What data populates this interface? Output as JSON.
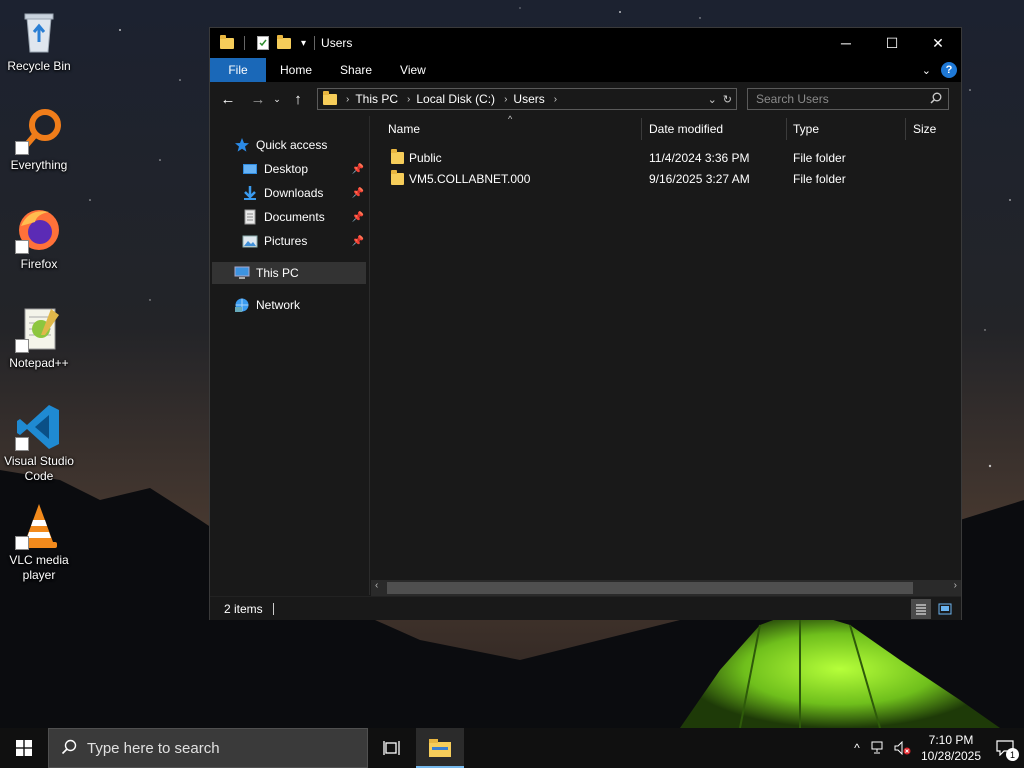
{
  "desktop": {
    "icons": [
      {
        "label": "Recycle Bin",
        "icon": "recycle-bin-icon"
      },
      {
        "label": "Everything",
        "icon": "everything-search-icon"
      },
      {
        "label": "Firefox",
        "icon": "firefox-icon"
      },
      {
        "label": "Notepad++",
        "icon": "notepad-plus-plus-icon"
      },
      {
        "label": "Visual Studio Code",
        "icon": "vscode-icon"
      },
      {
        "label": "VLC media player",
        "icon": "vlc-icon"
      }
    ]
  },
  "window": {
    "title": "Users",
    "controls": {
      "minimize": "─",
      "maximize": "☐",
      "close": "✕"
    }
  },
  "ribbon": {
    "tabs": [
      "File",
      "Home",
      "Share",
      "View"
    ]
  },
  "address": {
    "crumbs": [
      "This PC",
      "Local Disk (C:)",
      "Users"
    ]
  },
  "search": {
    "placeholder": "Search Users"
  },
  "navpane": {
    "items": [
      {
        "label": "Quick access",
        "icon": "star-icon",
        "pinned": false
      },
      {
        "label": "Desktop",
        "icon": "desktop-folder-icon",
        "pinned": true
      },
      {
        "label": "Downloads",
        "icon": "downloads-icon",
        "pinned": true
      },
      {
        "label": "Documents",
        "icon": "documents-icon",
        "pinned": true
      },
      {
        "label": "Pictures",
        "icon": "pictures-icon",
        "pinned": true
      },
      {
        "label": "This PC",
        "icon": "this-pc-icon",
        "selected": true
      },
      {
        "label": "Network",
        "icon": "network-icon"
      }
    ]
  },
  "columns": [
    "Name",
    "Date modified",
    "Type",
    "Size"
  ],
  "files": [
    {
      "name": "Public",
      "date": "11/4/2024 3:36 PM",
      "type": "File folder",
      "size": ""
    },
    {
      "name": "VM5.COLLABNET.000",
      "date": "9/16/2025 3:27 AM",
      "type": "File folder",
      "size": ""
    }
  ],
  "status": {
    "items": "2 items"
  },
  "taskbar": {
    "search_placeholder": "Type here to search",
    "time": "7:10 PM",
    "date": "10/28/2025",
    "notification_count": "1"
  }
}
